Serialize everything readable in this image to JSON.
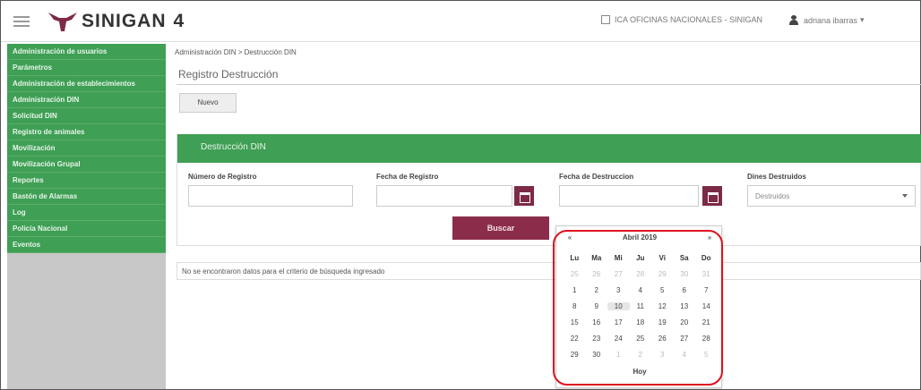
{
  "app": {
    "logo_text": "SINIGAN",
    "version": "4",
    "office": "ICA OFICINAS NACIONALES - SINIGAN",
    "user": "adriana ibarras"
  },
  "colors": {
    "green": "#3f9f55",
    "maroon": "#8b2d4a",
    "highlight": "#e0101e"
  },
  "sidebar": {
    "items": [
      {
        "label": "Administración de usuarios"
      },
      {
        "label": "Parámetros"
      },
      {
        "label": "Administración de establecimientos"
      },
      {
        "label": "Administración DIN"
      },
      {
        "label": "Solicitud DIN"
      },
      {
        "label": "Registro de animales"
      },
      {
        "label": "Movilización"
      },
      {
        "label": "Movilización Grupal"
      },
      {
        "label": "Reportes"
      },
      {
        "label": "Bastón de Alarmas"
      },
      {
        "label": "Log"
      },
      {
        "label": "Policía Nacional"
      },
      {
        "label": "Eventos"
      }
    ]
  },
  "main": {
    "breadcrumb": "Administración DIN > Destrucción DIN",
    "page_title": "Registro Destrucción",
    "new_button": "Nuevo",
    "panel_title": "Destrucción DIN",
    "fields": {
      "numero_label": "Número de Registro",
      "fecha_registro_label": "Fecha de Registro",
      "fecha_destruccion_label": "Fecha de Destruccion",
      "dines_label": "Dines Destruidos",
      "dines_selected": "Destruidos"
    },
    "search_button": "Buscar",
    "result_message": "No se encontraron datos para el criterio de búsqueda ingresado"
  },
  "calendar": {
    "prev": "«",
    "next": "»",
    "title": "Abril 2019",
    "weekdays": [
      "Lu",
      "Ma",
      "Mi",
      "Ju",
      "Vi",
      "Sa",
      "Do"
    ],
    "weeks": [
      [
        {
          "d": "25",
          "m": true
        },
        {
          "d": "26",
          "m": true
        },
        {
          "d": "27",
          "m": true
        },
        {
          "d": "28",
          "m": true
        },
        {
          "d": "29",
          "m": true
        },
        {
          "d": "30",
          "m": true
        },
        {
          "d": "31",
          "m": true
        }
      ],
      [
        {
          "d": "1"
        },
        {
          "d": "2"
        },
        {
          "d": "3"
        },
        {
          "d": "4"
        },
        {
          "d": "5"
        },
        {
          "d": "6"
        },
        {
          "d": "7"
        }
      ],
      [
        {
          "d": "8"
        },
        {
          "d": "9"
        },
        {
          "d": "10",
          "t": true
        },
        {
          "d": "11"
        },
        {
          "d": "12"
        },
        {
          "d": "13"
        },
        {
          "d": "14"
        }
      ],
      [
        {
          "d": "15"
        },
        {
          "d": "16"
        },
        {
          "d": "17"
        },
        {
          "d": "18"
        },
        {
          "d": "19"
        },
        {
          "d": "20"
        },
        {
          "d": "21"
        }
      ],
      [
        {
          "d": "22"
        },
        {
          "d": "23"
        },
        {
          "d": "24"
        },
        {
          "d": "25"
        },
        {
          "d": "26"
        },
        {
          "d": "27"
        },
        {
          "d": "28"
        }
      ],
      [
        {
          "d": "29"
        },
        {
          "d": "30"
        },
        {
          "d": "1",
          "m": true
        },
        {
          "d": "2",
          "m": true
        },
        {
          "d": "3",
          "m": true
        },
        {
          "d": "4",
          "m": true
        },
        {
          "d": "5",
          "m": true
        }
      ]
    ],
    "today_label": "Hoy"
  }
}
